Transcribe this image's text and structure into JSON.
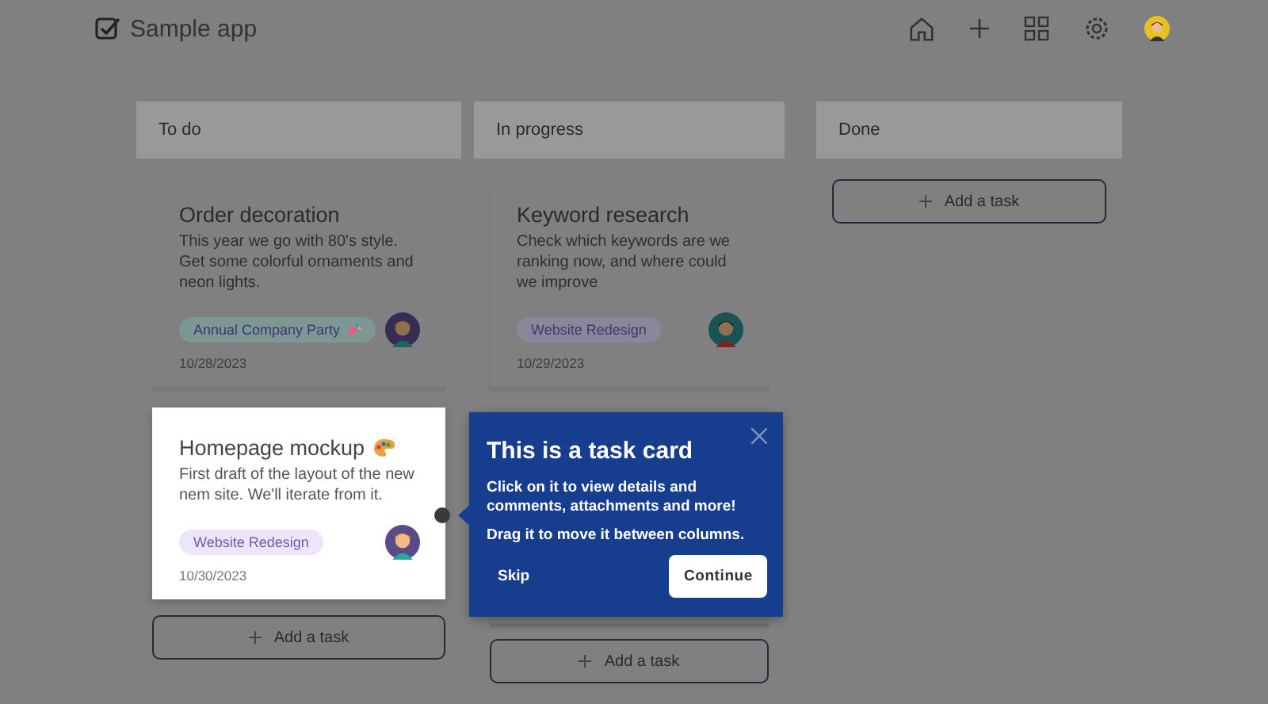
{
  "header": {
    "title": "Sample app"
  },
  "columns": [
    {
      "title": "To do",
      "cards": [
        {
          "title": "Order decoration",
          "description": "This year we go with 80's style. Get some colorful ornaments and neon lights.",
          "tag": {
            "label": "Annual Company Party",
            "color": "#7d9794"
          },
          "date": "10/28/2023",
          "highlighted": false
        },
        {
          "title": "Homepage mockup",
          "description": "First draft of the layout of the new nem site. We'll iterate from it.",
          "tag": {
            "label": "Website Redesign",
            "color": "#ede6fb"
          },
          "date": "10/30/2023",
          "highlighted": true
        }
      ],
      "add_label": "Add a task"
    },
    {
      "title": "In progress",
      "cards": [
        {
          "title": "Keyword research",
          "description": "Check which keywords are we ranking now, and where could we improve",
          "tag": {
            "label": "Website Redesign",
            "color": "#8a879a"
          },
          "date": "10/29/2023",
          "highlighted": false
        },
        {
          "kind": "hidden"
        }
      ],
      "add_label": "Add a task"
    },
    {
      "title": "Done",
      "add_label": "Add a task"
    }
  ],
  "tour": {
    "title": "This is a task card",
    "paragraphs": [
      "Click on it to view details and comments, attachments and more!",
      "Drag it to move it between columns."
    ],
    "skip": "Skip",
    "continue": "Continue"
  }
}
